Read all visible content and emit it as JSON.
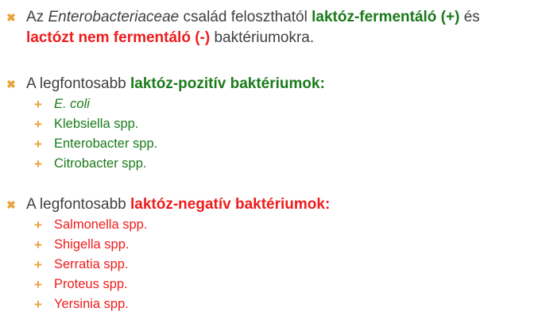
{
  "intro": {
    "bullet": "✖",
    "part1": "Az ",
    "family": "Enterobacteriaceae",
    "part2": " család feloszthatól ",
    "fermenting": "laktóz-fermentáló (+)",
    "part3": " és",
    "non_fermenting": "lactózt nem fermentáló (-)",
    "part4": " baktériumokra."
  },
  "positive": {
    "bullet": "✖",
    "lead": "A legfontosabb ",
    "heading": "laktóz-pozitív baktériumok:",
    "items": [
      "E. coli",
      "Klebsiella spp.",
      "Enterobacter spp.",
      "Citrobacter spp."
    ]
  },
  "negative": {
    "bullet": "✖",
    "lead": "A legfontosabb ",
    "heading": "laktóz-negatív baktériumok:",
    "items": [
      "Salmonella spp.",
      "Shigella spp.",
      "Serratia spp.",
      "Proteus spp.",
      "Yersinia spp."
    ]
  },
  "sub_bullet": "+",
  "colors": {
    "bullet": "#e8a33a",
    "positive": "#1a7a1a",
    "negative": "#ee1c1c",
    "text": "#404040"
  }
}
